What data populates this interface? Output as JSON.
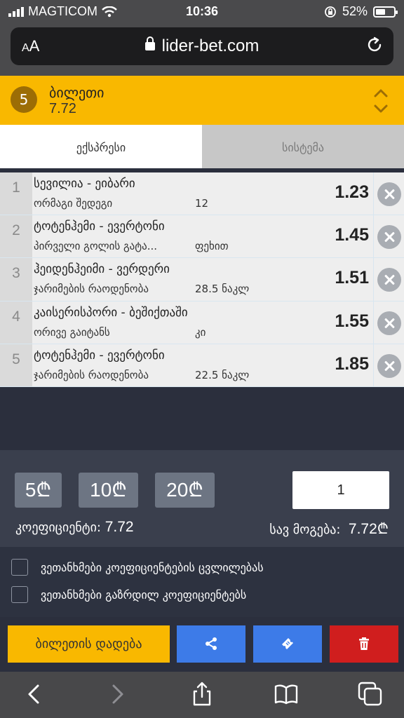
{
  "status_bar": {
    "carrier": "MAGTICOM",
    "time": "10:36",
    "battery": "52%"
  },
  "address_bar": {
    "text_size": "AA",
    "url": "lider-bet.com"
  },
  "ticket": {
    "count": "5",
    "title": "ბილეთი",
    "total_odds": "7.72"
  },
  "tabs": [
    {
      "label": "ექსპრესი",
      "active": true
    },
    {
      "label": "სისტემა",
      "active": false
    }
  ],
  "bets": [
    {
      "index": "1",
      "event": "სევილია - ეიბარი",
      "market": "ორმაგი შედეგი",
      "pick": "12",
      "odds": "1.23"
    },
    {
      "index": "2",
      "event": "ტოტენჰემი - ევერტონი",
      "market": "პირველი გოლის გატა...",
      "pick": "ფეხით",
      "odds": "1.45"
    },
    {
      "index": "3",
      "event": "ჰეიდენჰეიმი - ვერდერი",
      "market": "ჯარიმების რაოდენობა",
      "pick": "28.5 ნაკლ",
      "odds": "1.51"
    },
    {
      "index": "4",
      "event": "კაისერისპორი - ბეშიქთაში",
      "market": "ორივე გაიტანს",
      "pick": "კი",
      "odds": "1.55"
    },
    {
      "index": "5",
      "event": "ტოტენჰემი - ევერტონი",
      "market": "ჯარიმების რაოდენობა",
      "pick": "22.5 ნაკლ",
      "odds": "1.85"
    }
  ],
  "stake": {
    "chips": [
      "5₾",
      "10₾",
      "20₾"
    ],
    "amount": "1",
    "coef_label": "კოეფიციენტი:",
    "coef_value": "7.72",
    "win_label": "სავ მოგება:",
    "win_value": "7.72₾"
  },
  "checkboxes": [
    {
      "label": "ვეთანხმები კოეფიციენტების ცვლილებას",
      "checked": false
    },
    {
      "label": "ვეთანხმები გაზრდილ კოეფიციენტებს",
      "checked": false
    }
  ],
  "actions": {
    "place_bet_label": "ბილეთის დადება"
  },
  "colors": {
    "accent": "#f9b800",
    "share": "#3d7be8",
    "ticket_btn": "#3d7be8",
    "delete": "#d01e1e"
  },
  "icons": [
    "signal-icon",
    "wifi-icon",
    "rotation-lock-icon",
    "battery-icon",
    "lock-icon",
    "reload-icon",
    "sort-toggle-icon",
    "remove-icon",
    "share-icon",
    "ticket-icon",
    "trash-icon",
    "back-icon",
    "forward-icon",
    "share-sheet-icon",
    "bookmarks-icon",
    "tabs-icon"
  ]
}
